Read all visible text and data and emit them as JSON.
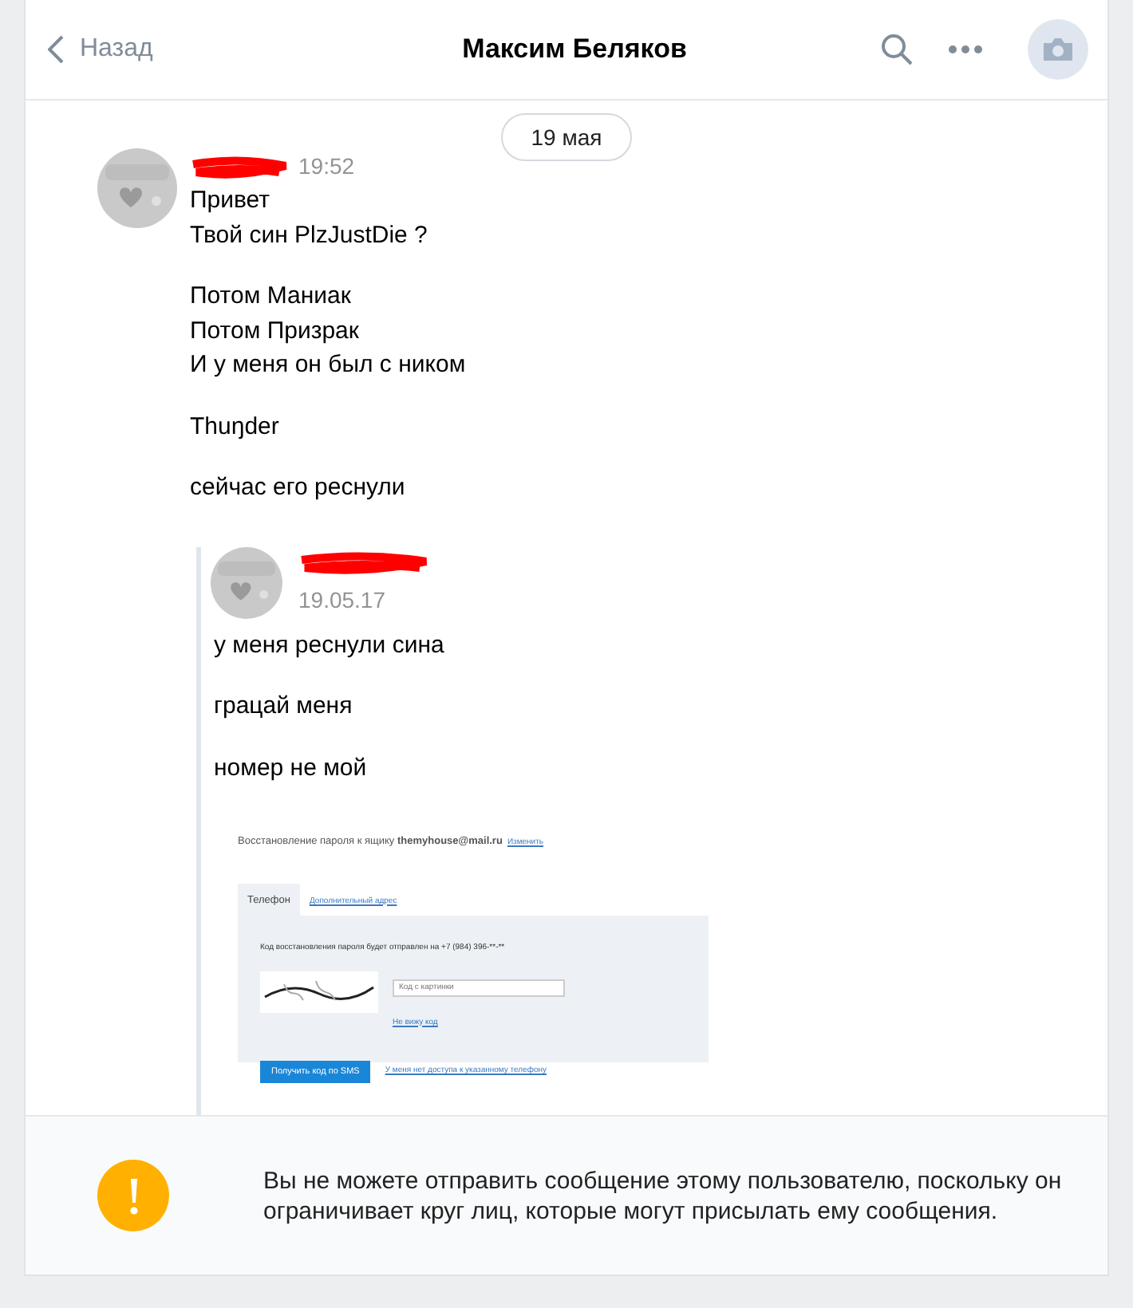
{
  "header": {
    "back_label": "Назад",
    "title": "Максим Беляков"
  },
  "date_pill": "19 мая",
  "message": {
    "time": "19:52",
    "paragraphs": [
      [
        "Привет",
        "Твой син PlzJustDie ?"
      ],
      [
        "Потом Маниак",
        "Потом Призрак",
        "И у меня он был с ником"
      ],
      [
        "Thuŋder"
      ],
      [
        "сейчас его реснули"
      ]
    ],
    "forwarded": {
      "date": "19.05.17",
      "paragraphs": [
        "у меня реснули сина",
        "грацай меня",
        "номер не мой"
      ],
      "attachment": {
        "heading": "Восстановление пароля к ящику **themyhouse@mail.ru**",
        "change_link": "Изменить",
        "tabs": [
          {
            "label": "Телефон",
            "selected": true
          },
          {
            "label": "Дополнительный адрес",
            "selected": false
          }
        ],
        "notice": "Код восстановления пароля будет отправлен на +7 (984) 396-**-**",
        "captcha_placeholder": "Код с картинки",
        "cant_see_link": "Не вижу код",
        "button": "Получить код по SMS",
        "no_access_link": "У меня нет доступа к указанному телефону"
      }
    }
  },
  "footer": {
    "text": "Вы не можете отправить сообщение этому пользователю, поскольку он ограничивает круг лиц, которые могут присылать ему сообщения."
  }
}
